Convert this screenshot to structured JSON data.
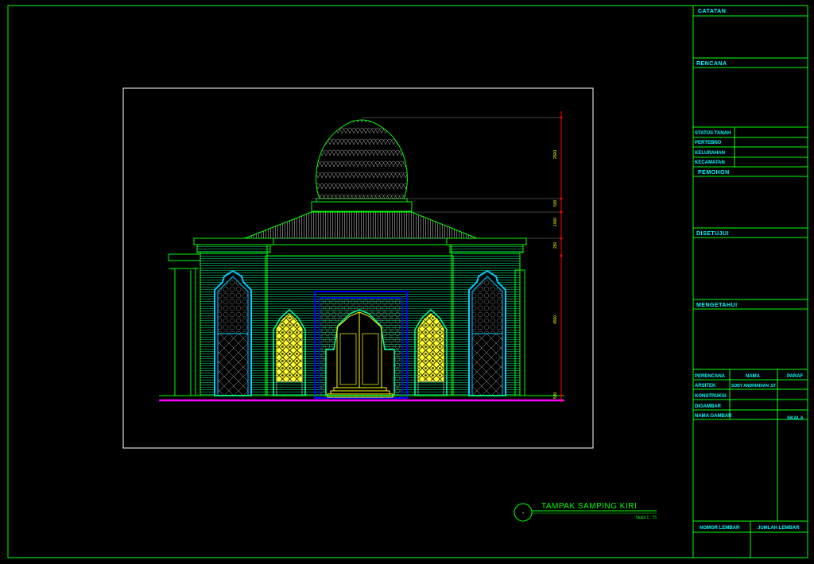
{
  "title_block": {
    "catatan": "CATATAN",
    "rencana": "RENCANA",
    "rows_top": [
      "STATUS TANAH",
      "PERTEBNO",
      "KELURAHAN",
      "KECAMATAN"
    ],
    "pemohon": "PEMOHON",
    "disetujui": "DISETUJUI",
    "mengetahui": "MENGETAHUI",
    "col_perencana": "PERENCANA",
    "col_nama": "NAMA",
    "col_paraf": "PARAF",
    "arsitek": "ARSITEK",
    "arsitek_name": "SOBY ANDRIADIAN ,ST",
    "konstruksi": "KONSTRUKSI",
    "digambar": "DIGAMBAR",
    "nama_gambar": "NAMA GAMBAR",
    "skala": "SKALA",
    "nomor_lembar": "NOMOR LEMBAR",
    "jumlah_lembar": "JUMLAH LEMBAR"
  },
  "drawing": {
    "title": "TAMPAK SAMPING KIRI",
    "scale": "Skala 1 : 75",
    "marker": "-",
    "dimensions": [
      "2500",
      "500",
      "1000",
      "250",
      "4500",
      "500"
    ]
  },
  "colors": {
    "background": "#000000",
    "frame": "#00ff00",
    "white": "#ffffff",
    "cyan": "#00ffff",
    "yellow": "#ffff00",
    "magenta": "#ff00ff",
    "red": "#ff0000",
    "blue": "#0000ff"
  }
}
